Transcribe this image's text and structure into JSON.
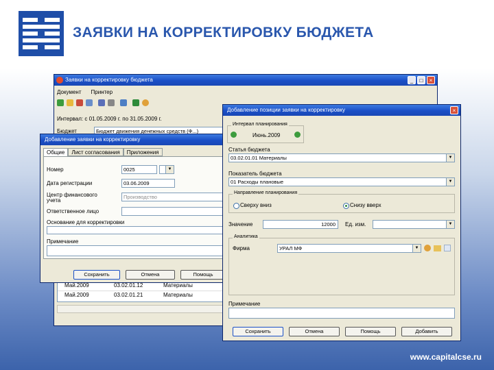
{
  "slide": {
    "title": "ЗАЯВКИ НА КОРРЕКТИРОВКУ БЮДЖЕТА",
    "footer_url": "www.capitalcse.ru",
    "colors": {
      "accent": "#2a57ad",
      "titlebar": "#1a4fc6",
      "window_bg": "#ece9d8"
    }
  },
  "main_window": {
    "title": "Заявки на корректировку бюджета",
    "menu": [
      "Документ",
      "Принтер"
    ],
    "toolbar_icons": [
      "add-icon",
      "edit-icon",
      "delete-icon",
      "copy-icon",
      "save-icon",
      "print-icon",
      "filter-icon",
      "check-icon",
      "help-icon"
    ],
    "period": "Интервал: с 01.05.2009 г. по 31.05.2009 г.",
    "filter_label": "Бюджет",
    "filter_value": "Бюджет движения денежных средств (Ф...)",
    "rows": [
      {
        "period": "Май.2009",
        "date": "03.02.01.12",
        "account": "Материалы"
      },
      {
        "period": "Май.2009",
        "date": "03.02.01.21",
        "account": "Материалы"
      }
    ]
  },
  "add_request": {
    "title": "Добавление заявки на корректировку",
    "tabs": [
      "Общие",
      "Лист согласования",
      "Приложения"
    ],
    "fields": {
      "number_label": "Номер",
      "number_value": "0025",
      "date_label": "Дата регистрации",
      "date_value": "03.06.2009",
      "status_label": "Центр финансового учета",
      "status_value": "Производство",
      "responsible_label": "Ответственное лицо",
      "reason_label": "Основание для корректировки",
      "note_label": "Примечание"
    },
    "buttons": {
      "ok": "Сохранить",
      "cancel": "Отмена",
      "help": "Помощь"
    }
  },
  "add_position": {
    "title": "Добавление позиции заявки на корректировку",
    "period_group": "Интервал планирования",
    "period_value": "Июнь.2009",
    "article_label": "Статья бюджета",
    "article_value": "03.02.01.01 Материалы",
    "indicator_label": "Показатель бюджета",
    "indicator_value": "01 Расходы плановые",
    "direction_group": "Направление планирования",
    "direction_options": [
      "Сверху вниз",
      "Снизу вверх"
    ],
    "direction_selected": 1,
    "value_label": "Значение",
    "value": "12000",
    "unit_label": "Ед. изм.",
    "analytics_group": "Аналитика",
    "firm_label": "Фирма",
    "firm_value": "УРАЛ МФ",
    "note_label": "Примечание",
    "buttons": {
      "save": "Сохранить",
      "cancel": "Отмена",
      "help": "Помощь",
      "add": "Добавить"
    }
  }
}
